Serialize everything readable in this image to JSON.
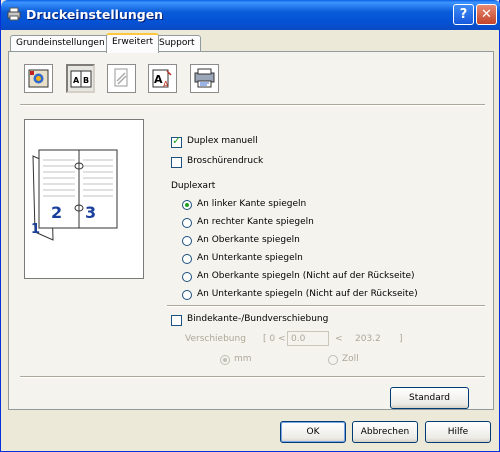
{
  "window": {
    "title": "Druckeinstellungen",
    "icon": "printer-icon"
  },
  "titlebar_buttons": {
    "help": "?",
    "close": "✕"
  },
  "tabs": [
    {
      "label": "Grundeinstellungen",
      "active": false
    },
    {
      "label": "Erweitert",
      "active": true
    },
    {
      "label": "Support",
      "active": false
    }
  ],
  "toolbar_icons": [
    "print-quality-icon",
    "duplex-icon",
    "watermark-icon",
    "page-setting-icon",
    "device-options-icon"
  ],
  "preview": {
    "page_left": "2",
    "page_right": "3",
    "page_back": "1"
  },
  "options": {
    "duplex_manual": {
      "label": "Duplex manuell",
      "checked": true
    },
    "booklet": {
      "label": "Broschürendruck",
      "checked": false
    }
  },
  "duplex_type": {
    "heading": "Duplexart",
    "choices": [
      {
        "label": "An linker Kante spiegeln",
        "selected": true
      },
      {
        "label": "An rechter Kante spiegeln",
        "selected": false
      },
      {
        "label": "An Oberkante spiegeln",
        "selected": false
      },
      {
        "label": "An Unterkante spiegeln",
        "selected": false
      },
      {
        "label": "An Oberkante spiegeln (Nicht auf der Rückseite)",
        "selected": false
      },
      {
        "label": "An Unterkante spiegeln (Nicht auf der Rückseite)",
        "selected": false
      }
    ]
  },
  "binding": {
    "label": "Bindekante-/Bundverschiebung",
    "checked": false,
    "offset_label": "Verschiebung",
    "range_open": "[ 0 <",
    "value": "0.0",
    "range_mid": "<",
    "range_max": "203.2",
    "range_close": "]",
    "unit_mm": "mm",
    "unit_inch": "Zoll",
    "unit_selected": "mm"
  },
  "buttons": {
    "standard": "Standard",
    "ok": "OK",
    "cancel": "Abbrechen",
    "help": "Hilfe"
  }
}
